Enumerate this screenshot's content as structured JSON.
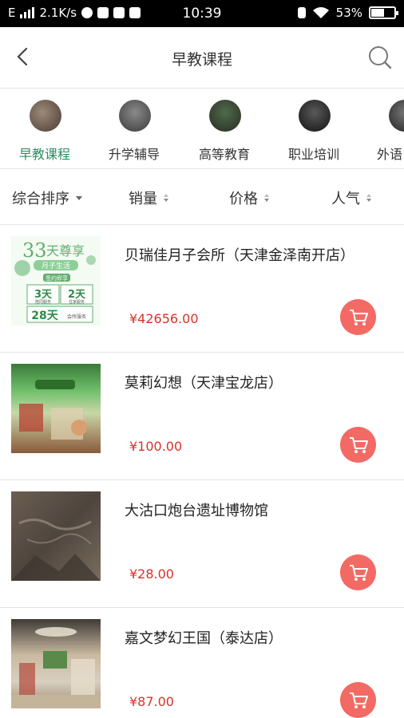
{
  "status_bar": {
    "network": "E",
    "speed": "2.1K/s",
    "time": "10:39",
    "battery": "53%"
  },
  "nav": {
    "title": "早教课程"
  },
  "categories": [
    {
      "label": "早教课程",
      "active": true
    },
    {
      "label": "升学辅导"
    },
    {
      "label": "高等教育"
    },
    {
      "label": "职业培训"
    },
    {
      "label": "外语"
    }
  ],
  "sort": {
    "comprehensive": "综合排序",
    "sales": "销量",
    "price": "价格",
    "popularity": "人气"
  },
  "products": [
    {
      "name": "贝瑞佳月子会所（天津金泽南开店）",
      "price": "¥42656.00",
      "image": {
        "headline_num": "33",
        "headline_text": "天尊享",
        "sub": "月子生活",
        "badge": "签约即享",
        "cells": [
          {
            "big": "3天",
            "small": "陪同服务"
          },
          {
            "big": "2天",
            "small": "住家服务"
          },
          {
            "big": "28天",
            "small": "会所服务"
          }
        ]
      }
    },
    {
      "name": "莫莉幻想（天津宝龙店）",
      "price": "¥100.00"
    },
    {
      "name": "大沽口炮台遗址博物馆",
      "price": "¥28.00"
    },
    {
      "name": "嘉文梦幻王国（泰达店）",
      "price": "¥87.00"
    }
  ],
  "colors": {
    "accent_green": "#2c8d5e",
    "price_red": "#d8332b",
    "cart_bg": "#f36a65"
  }
}
